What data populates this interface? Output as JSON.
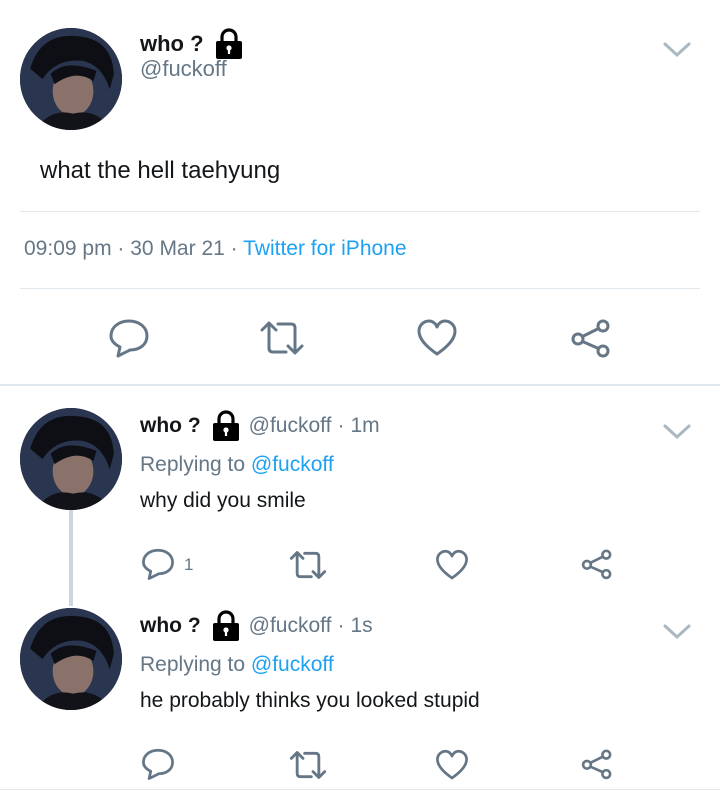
{
  "main_tweet": {
    "display_name": "who ?",
    "handle": "@fuckoff",
    "text": "what the hell taehyung",
    "time": "09:09 pm",
    "date": "30 Mar 21",
    "source": "Twitter for iPhone",
    "separator": "·"
  },
  "replies": [
    {
      "display_name": "who ?",
      "handle": "@fuckoff",
      "time": "1m",
      "replying_label": "Replying to",
      "replying_to": "@fuckoff",
      "text": "why did you smile",
      "reply_count": "1"
    },
    {
      "display_name": "who ?",
      "handle": "@fuckoff",
      "time": "1s",
      "replying_label": "Replying to",
      "replying_to": "@fuckoff",
      "text": "he probably thinks you looked stupid"
    }
  ],
  "colors": {
    "text": "#14171a",
    "secondary": "#657786",
    "link": "#1da1f2",
    "divider": "#e1e8ed"
  },
  "icons": [
    "lock-icon",
    "chevron-down-icon",
    "reply-icon",
    "retweet-icon",
    "like-icon",
    "share-icon"
  ]
}
